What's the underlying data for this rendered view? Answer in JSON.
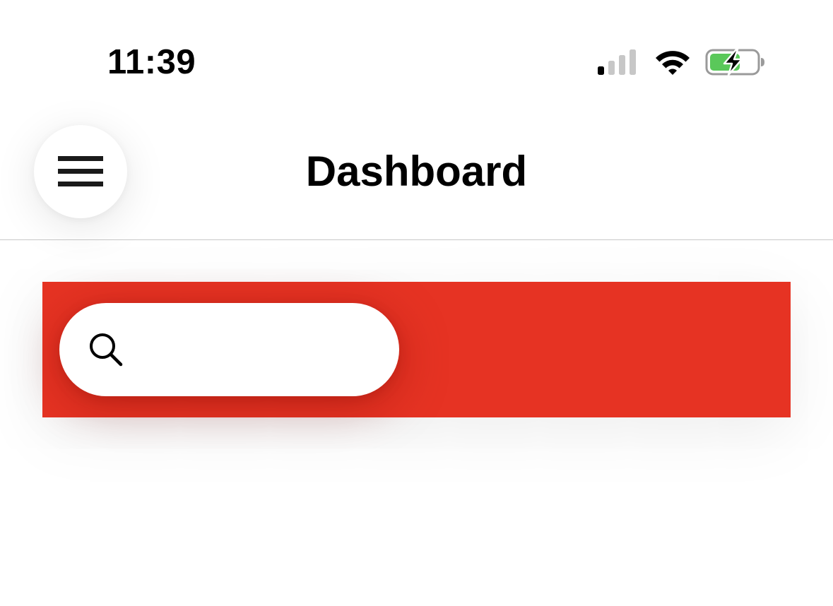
{
  "status_bar": {
    "time": "11:39",
    "icons": [
      "cellular-signal-icon",
      "wifi-icon",
      "battery-charging-icon"
    ],
    "signal_bars_active": 1,
    "signal_bars_total": 4,
    "battery_level": 0.62,
    "battery_charging": true,
    "battery_color": "#5ac85a"
  },
  "header": {
    "menu_icon": "hamburger-menu-icon",
    "title": "Dashboard"
  },
  "hero": {
    "background_color": "#e63323",
    "search": {
      "icon": "search-icon",
      "value": "",
      "placeholder": ""
    }
  }
}
